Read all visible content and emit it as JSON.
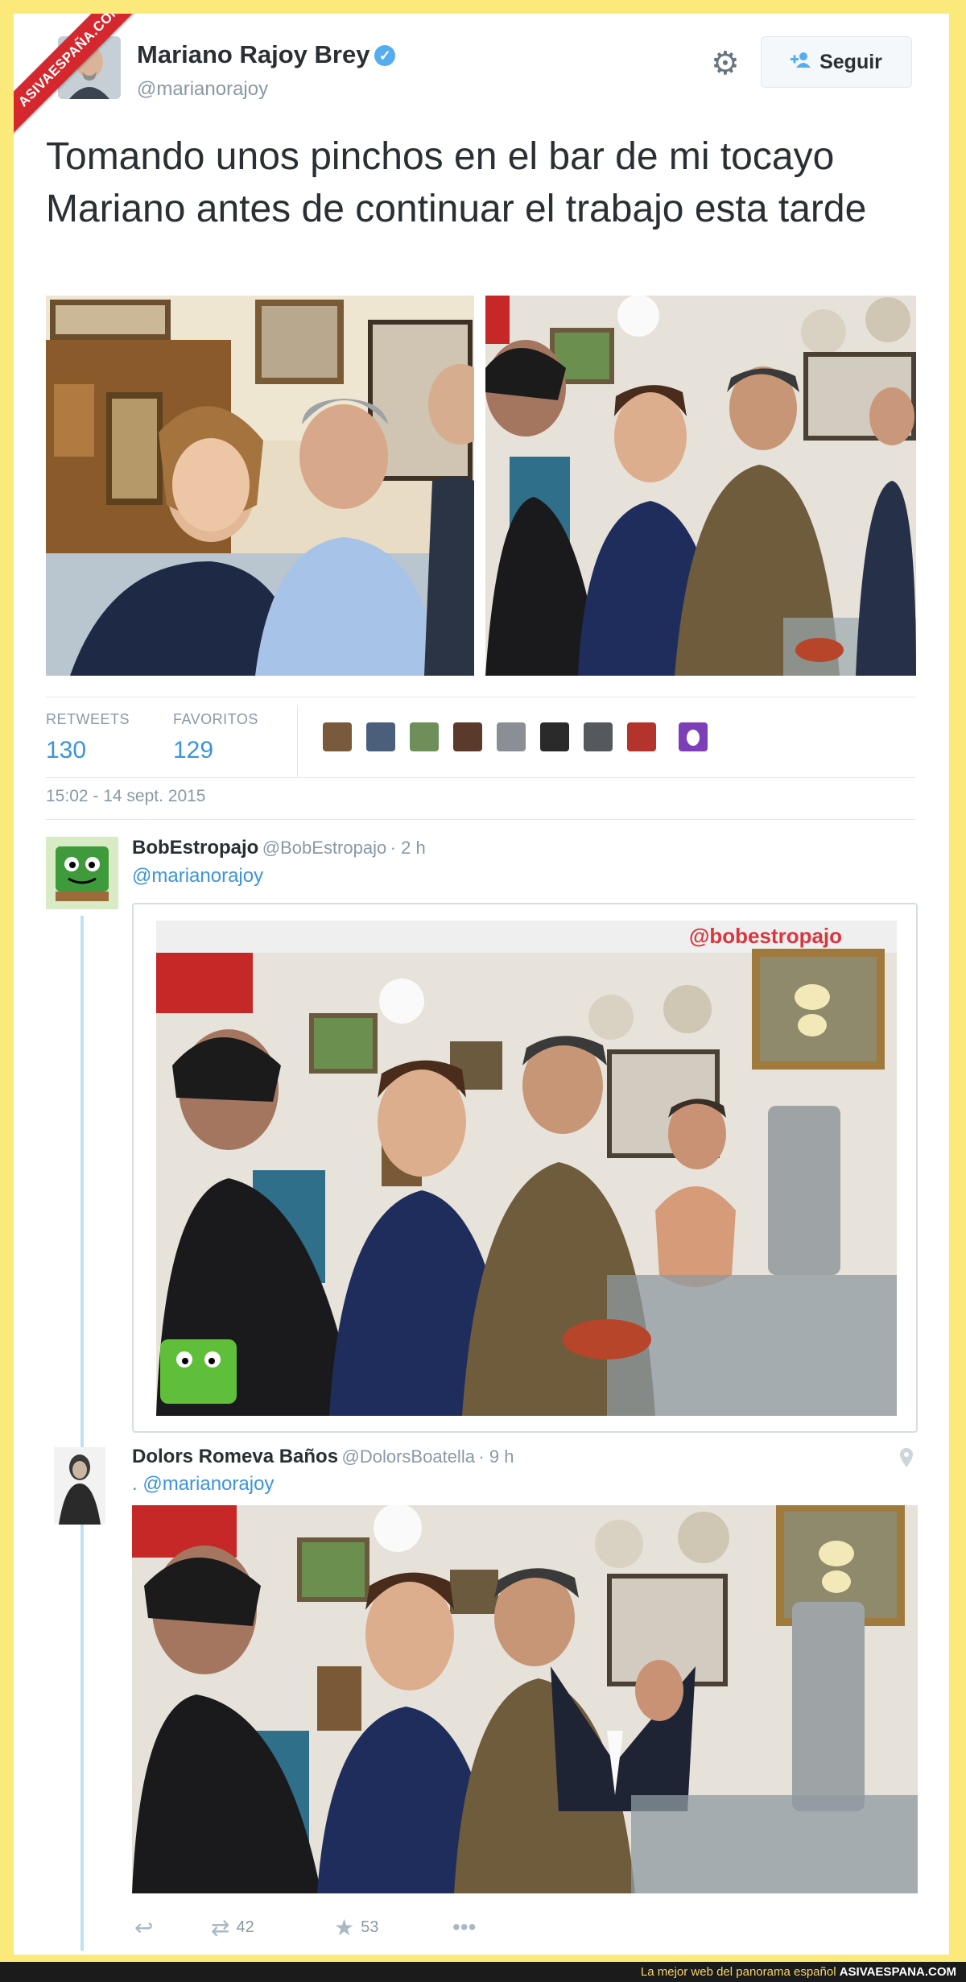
{
  "badge": {
    "text": "ASIVAESPAÑA.COM"
  },
  "tweet": {
    "author_name": "Mariano Rajoy Brey",
    "author_handle": "@marianorajoy",
    "follow_label": "Seguir",
    "text": "Tomando unos pinchos en el bar de mi tocayo Mariano antes de continuar el trabajo esta tarde",
    "retweets_label": "RETWEETS",
    "retweets_count": "130",
    "favorites_label": "FAVORITOS",
    "favorites_count": "129",
    "timestamp": "15:02 - 14 sept. 2015"
  },
  "replies": [
    {
      "name": "BobEstropajo",
      "handle": "@BobEstropajo",
      "time": "· 2 h",
      "mention": "@marianorajoy",
      "image_watermark": "@bobestropajo"
    },
    {
      "name": "Dolors Romeva Baños",
      "handle": "@DolorsBoatella",
      "time": "· 9 h",
      "mention": ". @marianorajoy",
      "retweet_count": "42",
      "like_count": "53"
    }
  ],
  "footer": {
    "text": "La mejor web del panorama español",
    "brand": "ASIVAESPANA.COM"
  },
  "colors": {
    "accent": "#3b94d9",
    "frame": "#fbe97a",
    "badge": "#d4282e"
  }
}
